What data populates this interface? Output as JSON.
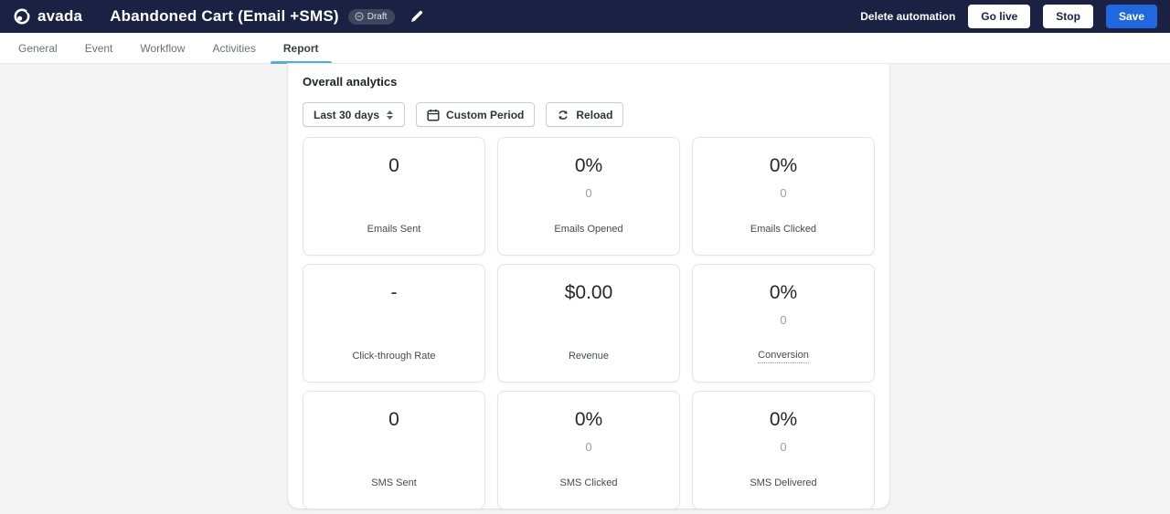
{
  "header": {
    "brand": "avada",
    "title": "Abandoned Cart (Email +SMS)",
    "status_badge": "Draft",
    "delete_label": "Delete automation",
    "go_live_label": "Go live",
    "stop_label": "Stop",
    "save_label": "Save"
  },
  "tabs": [
    {
      "label": "General"
    },
    {
      "label": "Event"
    },
    {
      "label": "Workflow"
    },
    {
      "label": "Activities"
    },
    {
      "label": "Report"
    }
  ],
  "active_tab": "Report",
  "analytics": {
    "heading": "Overall analytics",
    "period_selected": "Last 30 days",
    "custom_period_label": "Custom Period",
    "reload_label": "Reload",
    "cards": [
      {
        "value": "0",
        "sub": "",
        "label": "Emails Sent"
      },
      {
        "value": "0%",
        "sub": "0",
        "label": "Emails Opened"
      },
      {
        "value": "0%",
        "sub": "0",
        "label": "Emails Clicked"
      },
      {
        "value": "-",
        "sub": "",
        "label": "Click-through Rate"
      },
      {
        "value": "$0.00",
        "sub": "",
        "label": "Revenue"
      },
      {
        "value": "0%",
        "sub": "0",
        "label": "Conversion"
      },
      {
        "value": "0",
        "sub": "",
        "label": "SMS Sent"
      },
      {
        "value": "0%",
        "sub": "0",
        "label": "SMS Clicked"
      },
      {
        "value": "0%",
        "sub": "0",
        "label": "SMS Delivered"
      }
    ]
  },
  "colors": {
    "header_bg": "#1a2143",
    "save_button": "#1f68e0",
    "active_tab_underline": "#4fb1d8",
    "page_bg": "#f4f4f5"
  }
}
